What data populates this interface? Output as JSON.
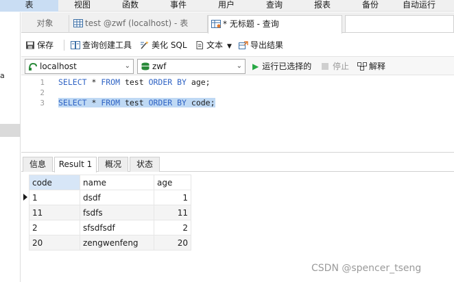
{
  "menu": [
    "表",
    "视图",
    "函数",
    "事件",
    "用户",
    "查询",
    "报表",
    "备份",
    "自动运行"
  ],
  "left_panel": {
    "fragment": "a"
  },
  "tabs": {
    "objects": "对象",
    "table_tab": "test @zwf (localhost) - 表",
    "query_tab": "* 无标题 - 查询"
  },
  "toolbar": {
    "save": "保存",
    "query_builder": "查询创建工具",
    "beautify_sql": "美化 SQL",
    "text": "文本",
    "export": "导出结果"
  },
  "connection": {
    "server": "localhost",
    "database": "zwf",
    "run_selected": "运行已选择的",
    "stop": "停止",
    "explain": "解释"
  },
  "editor": {
    "line_numbers": [
      "1",
      "2",
      "3"
    ],
    "lines": [
      {
        "kw1": "SELECT",
        "star": " * ",
        "kw2": "FROM",
        "table": " test ",
        "kw3": "ORDER BY",
        "rest": " age;"
      },
      {
        "kw1": "",
        "star": "",
        "kw2": "",
        "table": "",
        "kw3": "",
        "rest": ""
      },
      {
        "kw1": "SELECT",
        "star": " * ",
        "kw2": "FROM",
        "table": " test ",
        "kw3": "ORDER BY",
        "rest": " code;"
      }
    ]
  },
  "result_tabs": [
    "信息",
    "Result 1",
    "概况",
    "状态"
  ],
  "result_grid": {
    "columns": [
      "code",
      "name",
      "age"
    ],
    "rows": [
      [
        "1",
        "dsdf",
        "1"
      ],
      [
        "11",
        "fsdfs",
        "11"
      ],
      [
        "2",
        "sfsdfsdf",
        "2"
      ],
      [
        "20",
        "zengwenfeng",
        "20"
      ]
    ]
  },
  "watermark": "CSDN @spencer_tseng",
  "colors": {
    "menu_active": "#c9ddf3",
    "selection": "#bfd9f4",
    "keyword": "#2f63c4",
    "run_green": "#27a844"
  }
}
